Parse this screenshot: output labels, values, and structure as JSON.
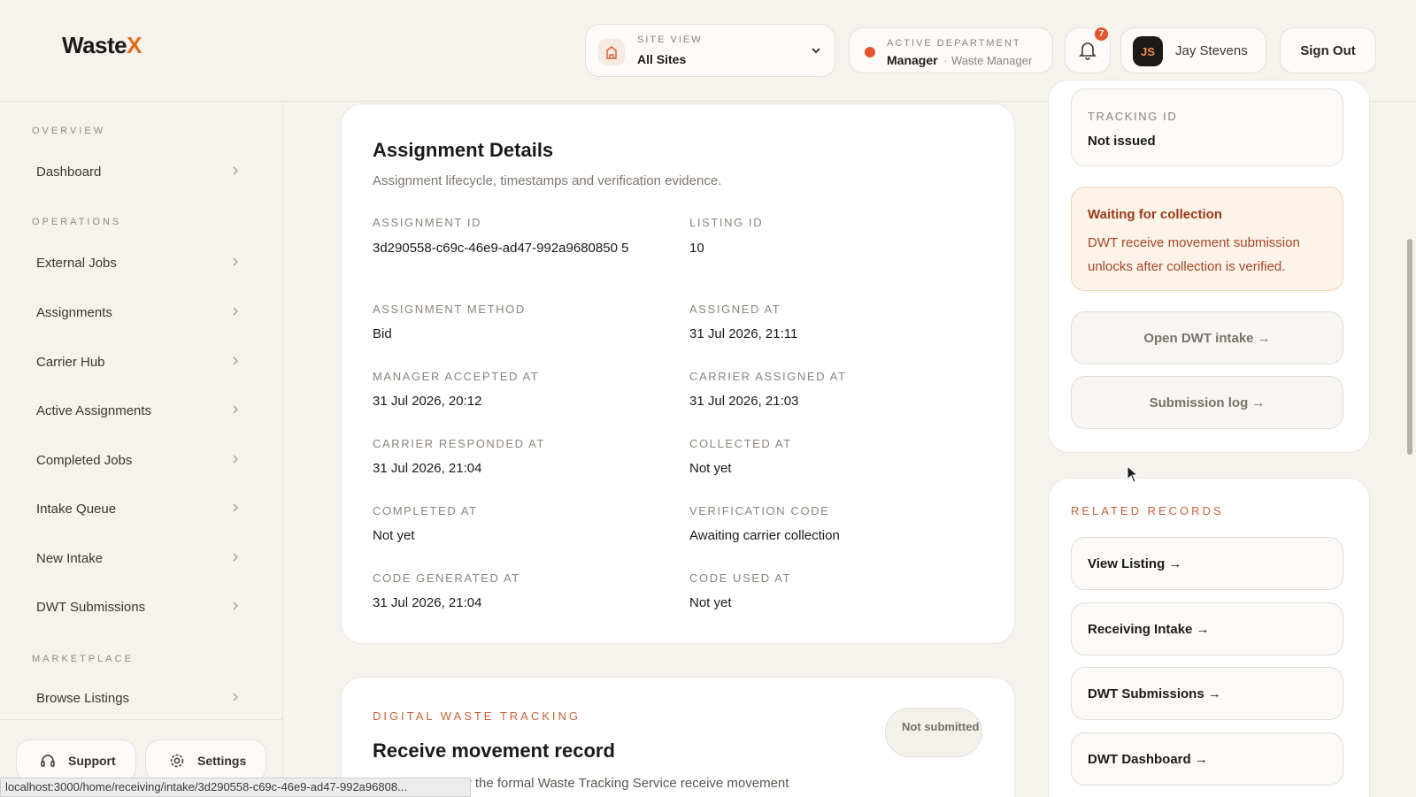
{
  "header": {
    "logo_text": "Waste",
    "logo_accent": "X",
    "site_view": {
      "label": "SITE VIEW",
      "value": "All Sites"
    },
    "department": {
      "label": "ACTIVE DEPARTMENT",
      "role": "Manager",
      "separator": "·",
      "title": "Waste Manager"
    },
    "notifications_count": "7",
    "user": {
      "initials": "JS",
      "name": "Jay Stevens"
    },
    "sign_out_label": "Sign Out"
  },
  "sidebar": {
    "sections": {
      "overview": "OVERVIEW",
      "operations": "OPERATIONS",
      "marketplace": "MARKETPLACE"
    },
    "items": [
      {
        "label": "Dashboard"
      },
      {
        "label": "External Jobs"
      },
      {
        "label": "Assignments"
      },
      {
        "label": "Carrier Hub"
      },
      {
        "label": "Active Assignments"
      },
      {
        "label": "Completed Jobs"
      },
      {
        "label": "Intake Queue"
      },
      {
        "label": "New Intake"
      },
      {
        "label": "DWT Submissions"
      },
      {
        "label": "Browse Listings"
      }
    ],
    "support_label": "Support",
    "settings_label": "Settings"
  },
  "status_url": "localhost:3000/home/receiving/intake/3d290558-c69c-46e9-ad47-992a96808...",
  "assignment": {
    "title": "Assignment Details",
    "subtitle": "Assignment lifecycle, timestamps and verification evidence.",
    "fields": [
      {
        "label": "ASSIGNMENT ID",
        "value": "3d290558-c69c-46e9-ad47-992a9680850 5"
      },
      {
        "label": "LISTING ID",
        "value": "10"
      },
      {
        "label": "ASSIGNMENT METHOD",
        "value": "Bid"
      },
      {
        "label": "ASSIGNED AT",
        "value": "31 Jul 2026, 21:11"
      },
      {
        "label": "MANAGER ACCEPTED AT",
        "value": "31 Jul 2026, 20:12"
      },
      {
        "label": "CARRIER ASSIGNED AT",
        "value": "31 Jul 2026, 21:03"
      },
      {
        "label": "CARRIER RESPONDED AT",
        "value": "31 Jul 2026, 21:04"
      },
      {
        "label": "COLLECTED AT",
        "value": "Not yet"
      },
      {
        "label": "COMPLETED AT",
        "value": "Not yet"
      },
      {
        "label": "VERIFICATION CODE",
        "value": "Awaiting carrier collection"
      },
      {
        "label": "CODE GENERATED AT",
        "value": "31 Jul 2026, 21:04"
      },
      {
        "label": "CODE USED AT",
        "value": "Not yet"
      }
    ]
  },
  "dwt": {
    "eyebrow": "DIGITAL WASTE TRACKING",
    "title": "Receive movement record",
    "status_pill": "Not submitted",
    "subtitle": "Submit or review the formal Waste Tracking Service receive movement"
  },
  "right": {
    "tracking": {
      "label": "TRACKING ID",
      "value": "Not issued"
    },
    "warning": {
      "title": "Waiting for collection",
      "body": "DWT receive movement submission unlocks after collection is verified."
    },
    "open_intake_label": "Open DWT intake →",
    "submission_log_label": "Submission log →",
    "related": {
      "label": "RELATED RECORDS",
      "links": [
        {
          "label": "View Listing →"
        },
        {
          "label": "Receiving Intake →"
        },
        {
          "label": "DWT Submissions →"
        },
        {
          "label": "DWT Dashboard →"
        }
      ]
    }
  }
}
